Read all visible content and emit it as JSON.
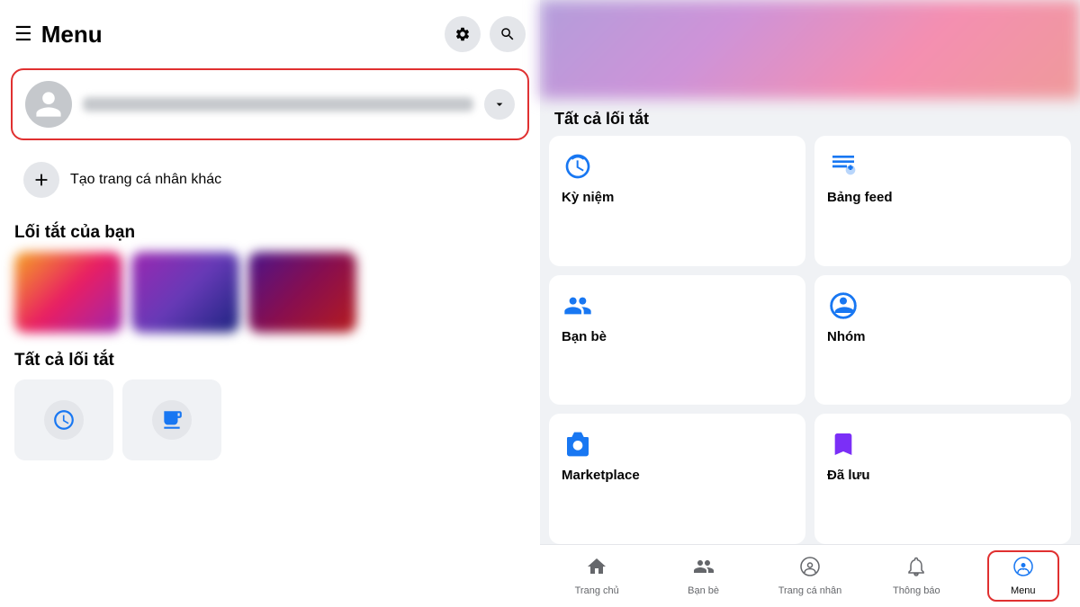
{
  "header": {
    "hamburger": "☰",
    "title": "Menu",
    "gear_icon": "⚙",
    "search_icon": "🔍"
  },
  "profile": {
    "name_placeholder": "Người dùng",
    "chevron": "⌄"
  },
  "create_profile": {
    "label": "Tạo trang cá nhân khác",
    "plus": "+"
  },
  "your_shortcuts": {
    "section_label": "Lối tắt của bạn"
  },
  "all_shortcuts_left": {
    "section_label": "Tất cả lối tắt"
  },
  "all_shortcuts_right": {
    "section_label": "Tất cả lối tắt"
  },
  "shortcut_cards": [
    {
      "id": "ky-niem",
      "label": "Kỳ niệm",
      "icon": "🕐"
    },
    {
      "id": "bang-feed",
      "label": "Bảng feed",
      "icon": "📋"
    },
    {
      "id": "ban-be",
      "label": "Bạn bè",
      "icon": "👥"
    },
    {
      "id": "nhom",
      "label": "Nhóm",
      "icon": "👨‍👩‍👧‍👦"
    },
    {
      "id": "marketplace",
      "label": "Marketplace",
      "icon": "🏪"
    },
    {
      "id": "da-luu",
      "label": "Đã lưu",
      "icon": "🔖"
    }
  ],
  "bottom_nav": [
    {
      "id": "trang-chu",
      "label": "Trang chủ",
      "icon": "🏠",
      "active": false
    },
    {
      "id": "ban-be",
      "label": "Bạn bè",
      "icon": "👥",
      "active": false
    },
    {
      "id": "trang-ca-nhan",
      "label": "Trang cá nhân",
      "icon": "👤",
      "active": false
    },
    {
      "id": "thong-bao",
      "label": "Thông báo",
      "icon": "🔔",
      "active": false
    },
    {
      "id": "menu",
      "label": "Menu",
      "icon": "👤",
      "active": true
    }
  ]
}
